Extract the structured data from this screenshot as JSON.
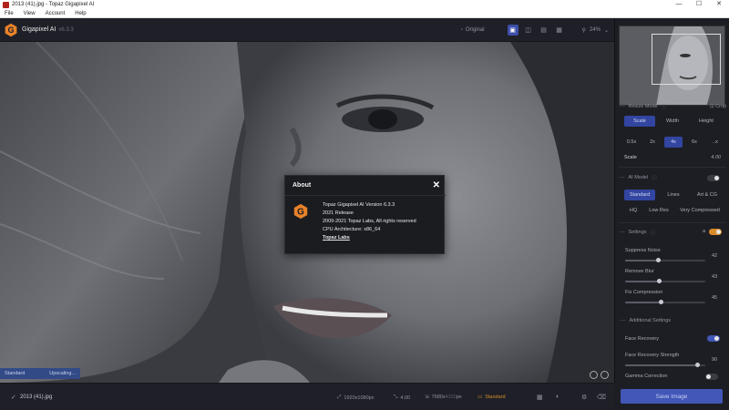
{
  "window": {
    "title": "2013 (41).jpg - Topaz Gigapixel AI",
    "minimize": "—",
    "maximize": "☐",
    "close": "✕"
  },
  "menu": {
    "items": [
      "File",
      "View",
      "Account",
      "Help"
    ]
  },
  "toolbar": {
    "app_name": "Gigapixel AI",
    "version": "v6.3.3",
    "original_label": "Original",
    "zoom": "24%"
  },
  "image_status": {
    "model": "Standard",
    "state": "Upscaling..."
  },
  "about": {
    "title": "About",
    "close": "✕",
    "lines": [
      "Topaz Gigapixel AI Version 6.3.3",
      "2021 Release",
      "2009-2021 Topaz Labs, All rights reserved",
      "CPU Architecture: x86_64"
    ],
    "link": "Topaz Labs"
  },
  "panel": {
    "resize_mode": {
      "label": "Resize Mode",
      "crop": "Crop",
      "tabs": [
        "Scale",
        "Width",
        "Height"
      ],
      "scales": [
        "0.5x",
        "2x",
        "4x",
        "6x",
        "..x"
      ],
      "active_scale": 2,
      "scale_label": "Scale",
      "scale_value": "4.00"
    },
    "ai_model": {
      "label": "AI Model",
      "row1": [
        "Standard",
        "Lines",
        "Art & CG"
      ],
      "row2": [
        "HQ",
        "Low Res",
        "Very Compressed"
      ]
    },
    "settings": {
      "label": "Settings",
      "auto_letter": "a",
      "sliders": [
        {
          "label": "Suppress Noise",
          "value": "42",
          "level": 0.42
        },
        {
          "label": "Remove Blur",
          "value": "43",
          "level": 0.43
        },
        {
          "label": "Fix Compression",
          "value": "45",
          "level": 0.45
        }
      ],
      "additional": "Additional Settings",
      "face_recovery": "Face Recovery",
      "face_strength": {
        "label": "Face Recovery Strength",
        "value": "90",
        "level": 0.9
      },
      "gamma": "Gamma Correction"
    },
    "save": "Save Image"
  },
  "bottom": {
    "file": "2013 (41).jpg",
    "input_size": "1920x1080px",
    "scale": "4.00",
    "output_size_a": "7680x",
    "output_size_b": "4320",
    "output_unit": "px",
    "model": "Standard"
  },
  "colors": {
    "accent": "#3d4fa8",
    "highlight": "#d98a2b",
    "logo": "#e8822a"
  }
}
